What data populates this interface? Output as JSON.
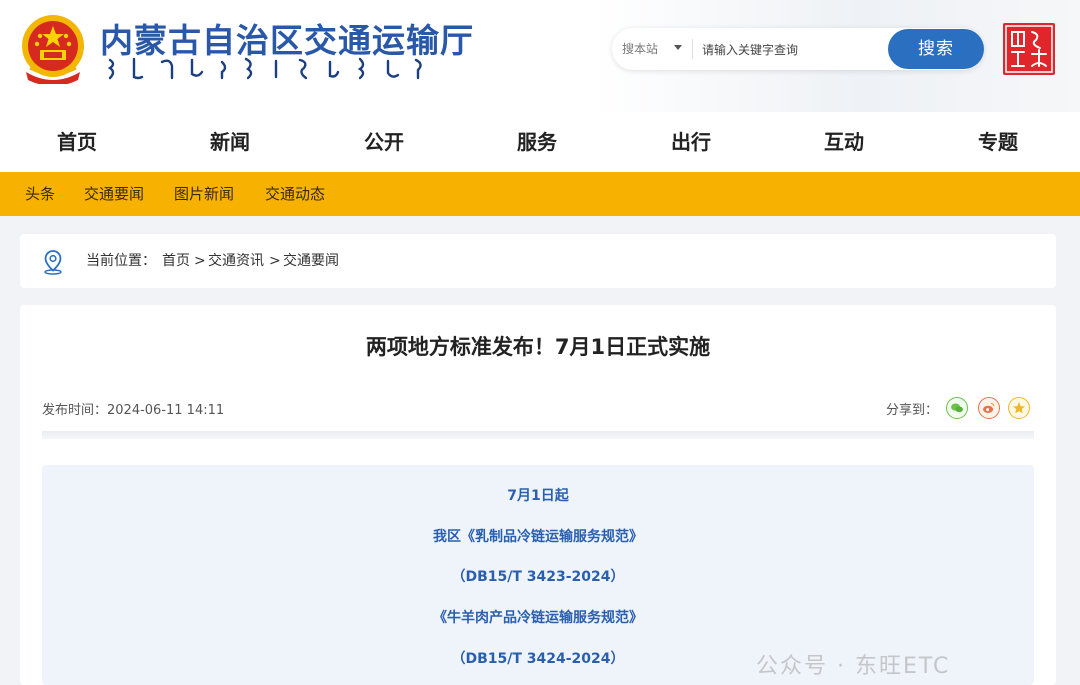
{
  "header": {
    "site_title": "内蒙古自治区交通运输厅",
    "search": {
      "scope": "搜本站",
      "placeholder": "请输入关键字查询",
      "button": "搜索"
    }
  },
  "main_nav": [
    "首页",
    "新闻",
    "公开",
    "服务",
    "出行",
    "互动",
    "专题"
  ],
  "sub_nav": [
    "头条",
    "交通要闻",
    "图片新闻",
    "交通动态"
  ],
  "breadcrumb": {
    "label": "当前位置：",
    "items": [
      "首页",
      "交通资讯",
      "交通要闻"
    ],
    "separator": ">"
  },
  "article": {
    "title": "两项地方标准发布！7月1日正式实施",
    "publish_time": "发布时间：2024-06-11 14:11",
    "share_label": "分享到：",
    "content_lines": [
      "7月1日起",
      "我区《乳制品冷链运输服务规范》",
      "（DB15/T 3423-2024）",
      "《牛羊肉产品冷链运输服务规范》",
      "（DB15/T 3424-2024）"
    ]
  },
  "watermark": "公众号 · 东旺ETC",
  "colors": {
    "brand_blue": "#2a58a8",
    "search_button": "#2b6fc0",
    "sub_nav_bg": "#f7b100",
    "content_text": "#2a5fb0"
  },
  "icons": [
    "national-emblem-icon",
    "mongolian-script-logo",
    "chevron-down-icon",
    "seal-icon",
    "location-pin-icon",
    "wechat-icon",
    "weibo-icon",
    "favorite-star-icon"
  ]
}
